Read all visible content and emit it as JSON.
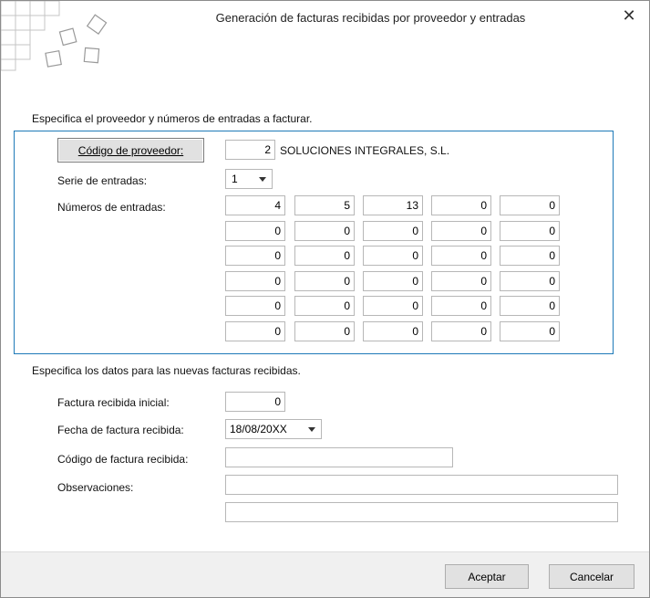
{
  "window": {
    "title": "Generación de facturas recibidas por proveedor y entradas",
    "close_icon": "close-icon"
  },
  "section1": {
    "label": "Especifica el proveedor y números de entradas a facturar."
  },
  "supplier": {
    "button_label": "Código de proveedor:",
    "code": "2",
    "name": "SOLUCIONES INTEGRALES, S.L."
  },
  "series": {
    "label": "Serie de entradas:",
    "value": "1"
  },
  "entries": {
    "label": "Números de entradas:",
    "rows": [
      [
        "4",
        "5",
        "13",
        "0",
        "0"
      ],
      [
        "0",
        "0",
        "0",
        "0",
        "0"
      ],
      [
        "0",
        "0",
        "0",
        "0",
        "0"
      ],
      [
        "0",
        "0",
        "0",
        "0",
        "0"
      ],
      [
        "0",
        "0",
        "0",
        "0",
        "0"
      ],
      [
        "0",
        "0",
        "0",
        "0",
        "0"
      ]
    ]
  },
  "section2": {
    "label": "Especifica los datos para las nuevas facturas recibidas."
  },
  "invoice": {
    "initial_label": "Factura recibida inicial:",
    "initial_value": "0",
    "date_label": "Fecha de factura recibida:",
    "date_value": "18/08/20XX",
    "code_label": "Código de factura recibida:",
    "code_value": "",
    "notes_label": "Observaciones:",
    "notes_line1": "",
    "notes_line2": ""
  },
  "buttons": {
    "accept": "Aceptar",
    "cancel": "Cancelar"
  },
  "colors": {
    "group_border": "#1e7ab8",
    "footer_bg": "#f0f0f0"
  }
}
